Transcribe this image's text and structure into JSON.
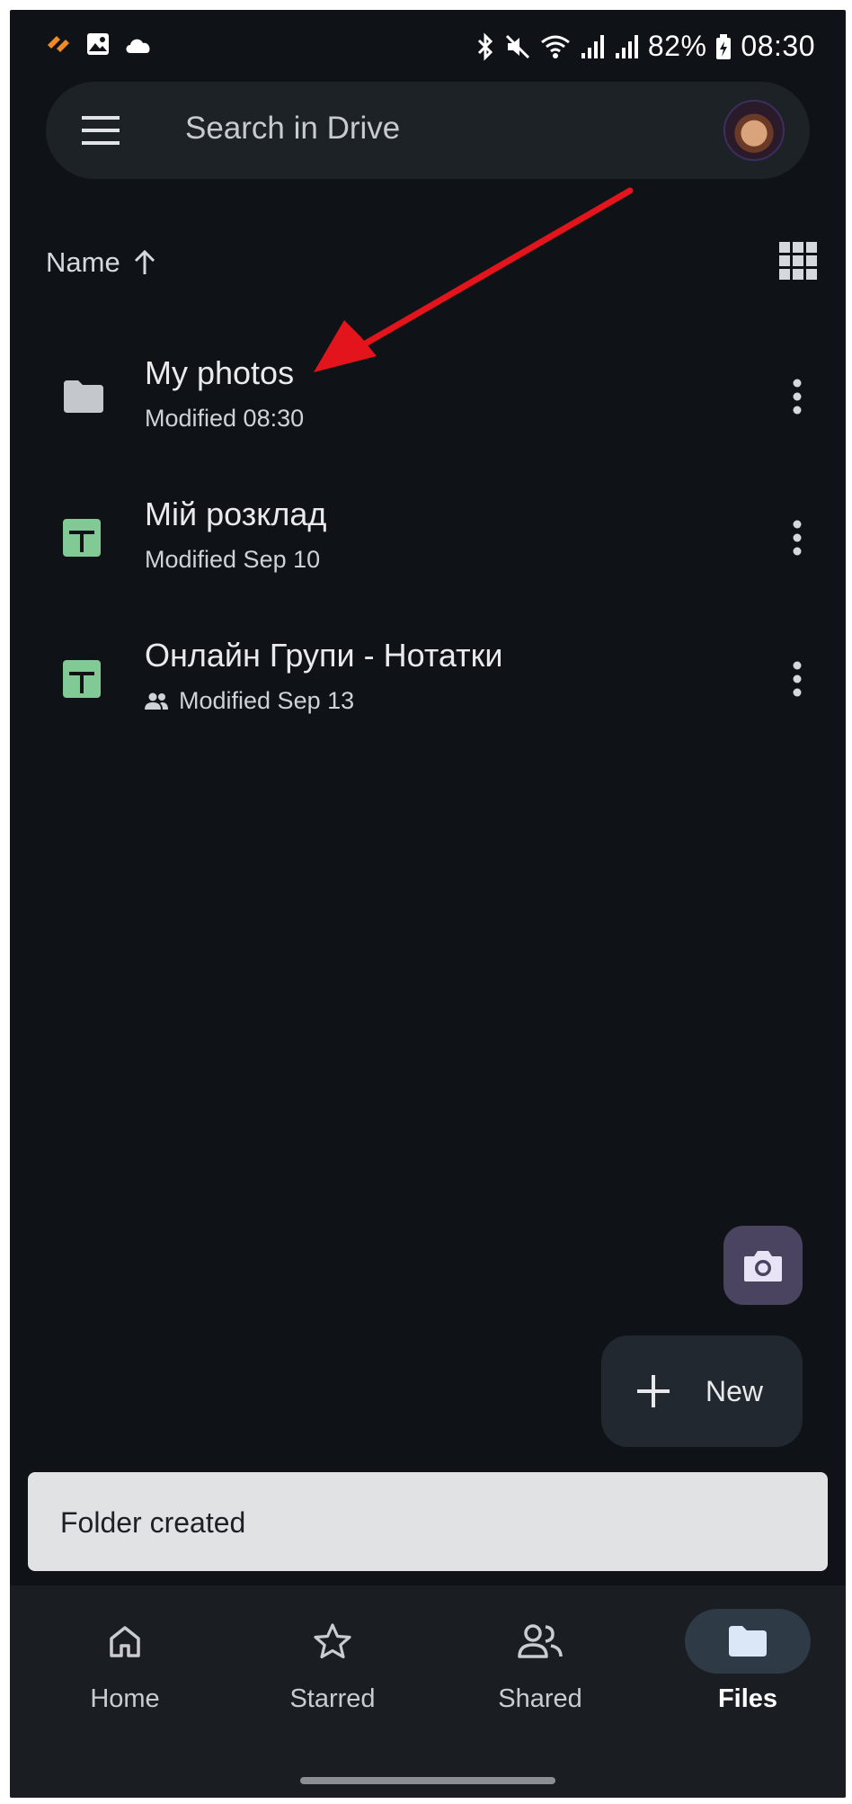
{
  "status_bar": {
    "battery": "82%",
    "time": "08:30"
  },
  "search": {
    "placeholder": "Search in Drive"
  },
  "sort": {
    "label": "Name"
  },
  "files": [
    {
      "name": "My photos",
      "meta": "Modified 08:30",
      "type": "folder",
      "shared": false
    },
    {
      "name": "Мій розклад",
      "meta": "Modified Sep 10",
      "type": "spreadsheet",
      "shared": false
    },
    {
      "name": "Онлайн Групи - Нотатки",
      "meta": "Modified Sep 13",
      "type": "spreadsheet",
      "shared": true
    }
  ],
  "fab": {
    "new_label": "New"
  },
  "snackbar": {
    "message": "Folder created"
  },
  "nav": [
    {
      "label": "Home",
      "icon": "home-icon",
      "active": false
    },
    {
      "label": "Starred",
      "icon": "star-icon",
      "active": false
    },
    {
      "label": "Shared",
      "icon": "people-icon",
      "active": false
    },
    {
      "label": "Files",
      "icon": "folder-icon",
      "active": true
    }
  ],
  "colors": {
    "background": "#0f1318",
    "sheet_green": "#81c995",
    "annotation_red": "#e3141b",
    "fab_camera": "#4b4460"
  }
}
